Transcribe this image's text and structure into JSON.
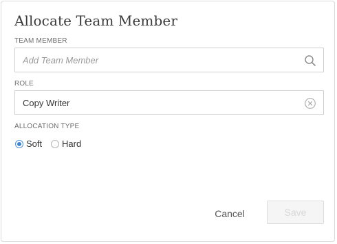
{
  "dialog": {
    "title": "Allocate Team Member"
  },
  "team_member": {
    "label": "TEAM MEMBER",
    "value": "",
    "placeholder": "Add Team Member",
    "icon": "search-icon"
  },
  "role": {
    "label": "ROLE",
    "value": "Copy Writer",
    "icon": "clear-icon"
  },
  "allocation_type": {
    "label": "ALLOCATION TYPE",
    "options": [
      {
        "label": "Soft",
        "checked": true
      },
      {
        "label": "Hard",
        "checked": false
      }
    ],
    "accent_color": "#3d85d6"
  },
  "actions": {
    "cancel_label": "Cancel",
    "save_label": "Save",
    "save_disabled": true
  }
}
